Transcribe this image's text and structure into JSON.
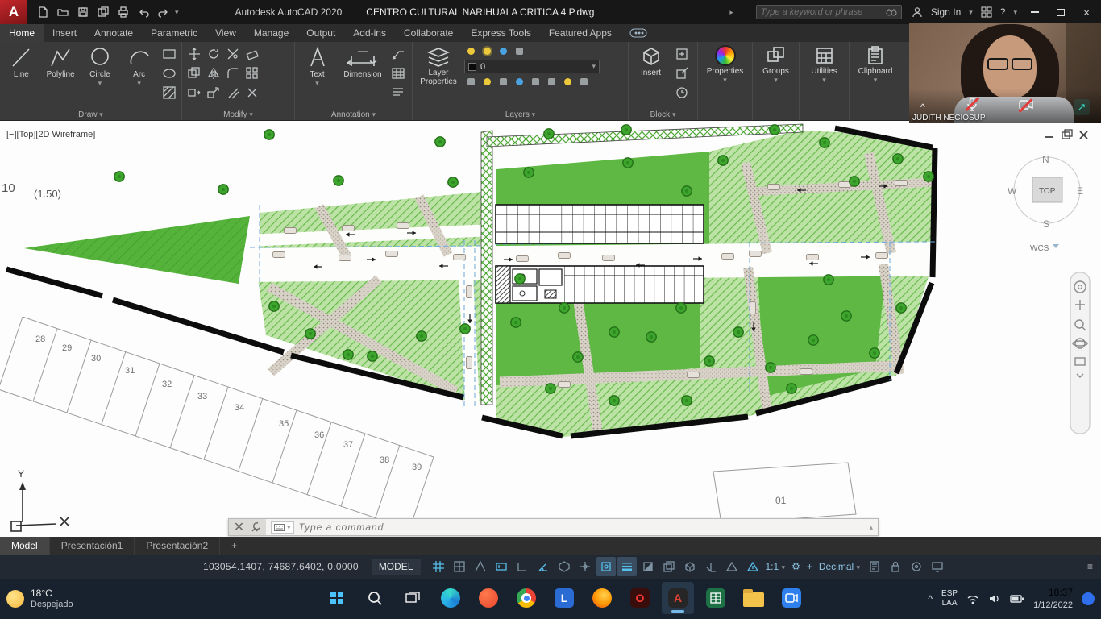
{
  "glyphs": {
    "close": "×",
    "min": "–",
    "chev_down": "▾",
    "chev_up": "▴",
    "chev_right": "▸",
    "menu": "≡",
    "plus": "+",
    "gear": "⚙",
    "caret": "^",
    "help": "?",
    "cross": "✕",
    "logo": "A",
    "share": "↗"
  },
  "titlebar": {
    "app_title": "Autodesk AutoCAD 2020",
    "doc_title": "CENTRO CULTURAL NARIHUALA CRITICA 4 P.dwg",
    "search_placeholder": "Type a keyword or phrase",
    "sign_in": "Sign In"
  },
  "ribbon": {
    "tabs": [
      {
        "label": "Home"
      },
      {
        "label": "Insert"
      },
      {
        "label": "Annotate"
      },
      {
        "label": "Parametric"
      },
      {
        "label": "View"
      },
      {
        "label": "Manage"
      },
      {
        "label": "Output"
      },
      {
        "label": "Add-ins"
      },
      {
        "label": "Collaborate"
      },
      {
        "label": "Express Tools"
      },
      {
        "label": "Featured Apps"
      }
    ],
    "draw": {
      "line": "Line",
      "polyline": "Polyline",
      "circle": "Circle",
      "arc": "Arc",
      "panel": "Draw"
    },
    "modify": {
      "panel": "Modify"
    },
    "annotation": {
      "text": "Text",
      "dimension": "Dimension",
      "panel": "Annotation"
    },
    "layers": {
      "layer_properties": "Layer Properties",
      "current_layer": "0",
      "panel": "Layers"
    },
    "block": {
      "insert": "Insert",
      "panel": "Block"
    },
    "properties": "Properties",
    "groups": "Groups",
    "utilities": "Utilities",
    "clipboard": "Clipboard"
  },
  "webcam": {
    "name": "JUDITH NECIOSUP"
  },
  "canvas": {
    "viewport_label": "[−][Top][2D Wireframe]",
    "note_10": "10",
    "note_scale": "(1.50)",
    "lots": [
      "28",
      "29",
      "30",
      "31",
      "32",
      "33",
      "34",
      "35",
      "36",
      "37",
      "38",
      "39"
    ],
    "lot_01": "01",
    "ucs_y": "Y",
    "compass": {
      "n": "N",
      "e": "E",
      "s": "S",
      "w": "W",
      "cube": "TOP",
      "wcs": "WCS"
    }
  },
  "command": {
    "placeholder": "Type a command"
  },
  "layout": {
    "model": "Model",
    "tab1": "Presentación1",
    "tab2": "Presentación2",
    "add": "+"
  },
  "status": {
    "coords": "103054.1407, 74687.6402, 0.0000",
    "model": "MODEL",
    "scale": "1:1",
    "units": "Decimal"
  },
  "taskbar": {
    "temp": "18°C",
    "condition": "Despejado",
    "docs_letter": "L",
    "opera_letter": "O",
    "autocad_letter": "A",
    "lang_top": "ESP",
    "lang_bottom": "LAA",
    "time": "18:37",
    "date": "1/12/2022"
  }
}
